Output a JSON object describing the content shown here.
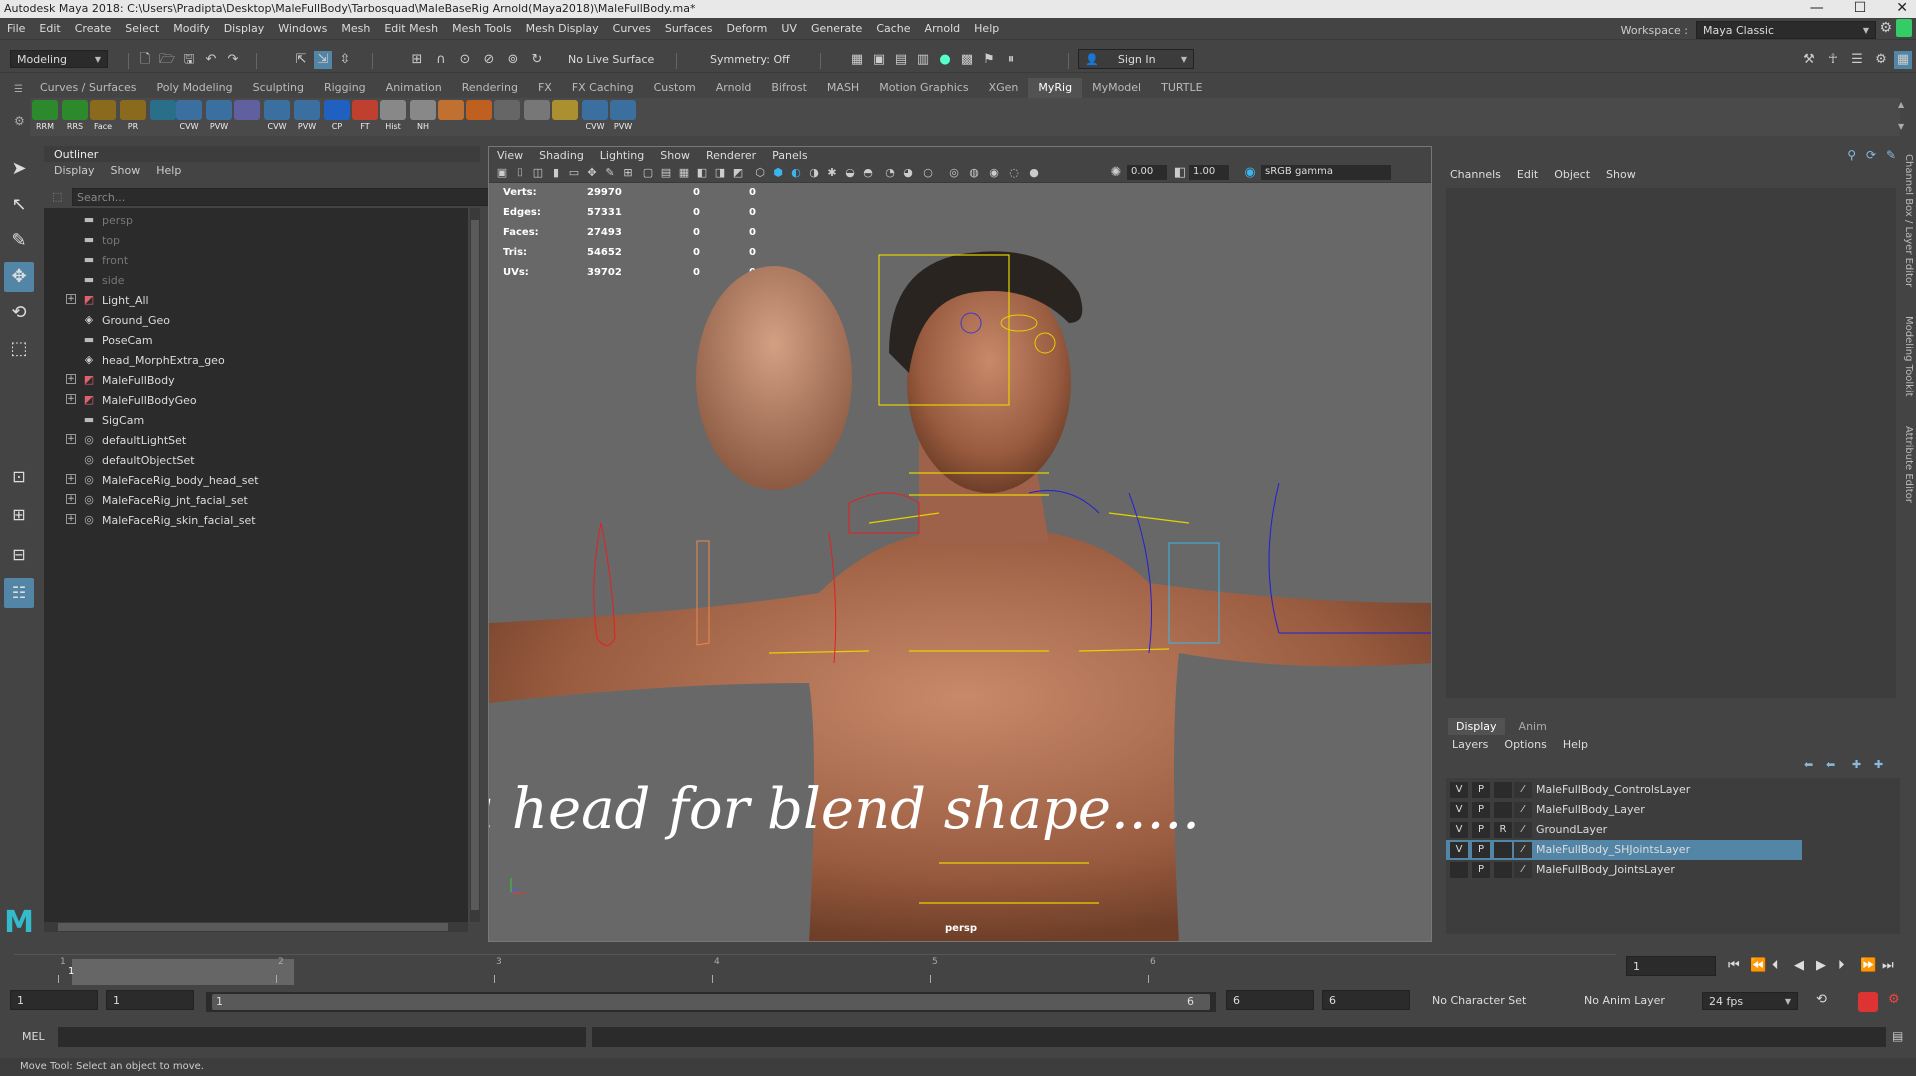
{
  "window": {
    "title": "Autodesk Maya 2018: C:\\Users\\Pradipta\\Desktop\\MaleFullBody\\Tarbosquad\\MaleBaseRig Arnold(Maya2018)\\MaleFullBody.ma*",
    "minimize": "—",
    "maximize": "☐",
    "close": "✕"
  },
  "menubar": {
    "items": [
      "File",
      "Edit",
      "Create",
      "Select",
      "Modify",
      "Display",
      "Windows",
      "Mesh",
      "Edit Mesh",
      "Mesh Tools",
      "Mesh Display",
      "Curves",
      "Surfaces",
      "Deform",
      "UV",
      "Generate",
      "Cache",
      "Arnold",
      "Help"
    ],
    "workspace_label": "Workspace :",
    "workspace_value": "Maya Classic"
  },
  "statusline": {
    "mode": "Modeling",
    "live_surface": "No Live Surface",
    "symmetry": "Symmetry: Off",
    "sign_in": "Sign In"
  },
  "shelf": {
    "tabs": [
      "Curves / Surfaces",
      "Poly Modeling",
      "Sculpting",
      "Rigging",
      "Animation",
      "Rendering",
      "FX",
      "FX Caching",
      "Custom",
      "Arnold",
      "Bifrost",
      "MASH",
      "Motion Graphics",
      "XGen",
      "MyRig",
      "MyModel",
      "TURTLE"
    ],
    "active_tab": "MyRig",
    "buttons": [
      "RRM",
      "RRS",
      "Face",
      "PR",
      "",
      "CVW",
      "PVW",
      "",
      "CVW",
      "PVW",
      "CP",
      "FT",
      "Hist",
      "NH",
      "",
      "",
      "",
      "",
      "",
      "CVW",
      "PVW"
    ]
  },
  "outliner": {
    "title": "Outliner",
    "menu": [
      "Display",
      "Show",
      "Help"
    ],
    "search_placeholder": "Search...",
    "items": [
      {
        "name": "persp",
        "icon": "camera-icon",
        "expand": false,
        "dim": true
      },
      {
        "name": "top",
        "icon": "camera-icon",
        "expand": false,
        "dim": true
      },
      {
        "name": "front",
        "icon": "camera-icon",
        "expand": false,
        "dim": true
      },
      {
        "name": "side",
        "icon": "camera-icon",
        "expand": false,
        "dim": true
      },
      {
        "name": "Light_All",
        "icon": "group-icon",
        "expand": true,
        "dim": false
      },
      {
        "name": "Ground_Geo",
        "icon": "mesh-icon",
        "expand": false,
        "dim": false
      },
      {
        "name": "PoseCam",
        "icon": "camera-icon",
        "expand": false,
        "dim": false
      },
      {
        "name": "head_MorphExtra_geo",
        "icon": "mesh-icon",
        "expand": false,
        "dim": false
      },
      {
        "name": "MaleFullBody",
        "icon": "group-icon",
        "expand": true,
        "dim": false
      },
      {
        "name": "MaleFullBodyGeo",
        "icon": "group-icon",
        "expand": true,
        "dim": false
      },
      {
        "name": "SigCam",
        "icon": "camera-icon",
        "expand": false,
        "dim": false
      },
      {
        "name": "defaultLightSet",
        "icon": "set-icon",
        "expand": true,
        "dim": false
      },
      {
        "name": "defaultObjectSet",
        "icon": "set-icon",
        "expand": false,
        "dim": false
      },
      {
        "name": "MaleFaceRig_body_head_set",
        "icon": "set-icon",
        "expand": true,
        "dim": false
      },
      {
        "name": "MaleFaceRig_jnt_facial_set",
        "icon": "set-icon",
        "expand": true,
        "dim": false
      },
      {
        "name": "MaleFaceRig_skin_facial_set",
        "icon": "set-icon",
        "expand": true,
        "dim": false
      }
    ]
  },
  "viewport": {
    "menu": [
      "View",
      "Shading",
      "Lighting",
      "Show",
      "Renderer",
      "Panels"
    ],
    "exposure": "0.00",
    "gamma": "1.00",
    "color_space": "sRGB gamma",
    "camera_label": "persp",
    "overlay_text": "Extra head for blend shape.....",
    "hud": [
      {
        "label": "Verts:",
        "v1": "29970",
        "v2": "0",
        "v3": "0"
      },
      {
        "label": "Edges:",
        "v1": "57331",
        "v2": "0",
        "v3": "0"
      },
      {
        "label": "Faces:",
        "v1": "27493",
        "v2": "0",
        "v3": "0"
      },
      {
        "label": "Tris:",
        "v1": "54652",
        "v2": "0",
        "v3": "0"
      },
      {
        "label": "UVs:",
        "v1": "39702",
        "v2": "0",
        "v3": "0"
      }
    ]
  },
  "channelbox": {
    "menu": [
      "Channels",
      "Edit",
      "Object",
      "Show"
    ]
  },
  "layer_editor": {
    "tabs": [
      "Display",
      "Anim"
    ],
    "active_tab": "Display",
    "menu": [
      "Layers",
      "Options",
      "Help"
    ],
    "layers": [
      {
        "v": "V",
        "p": "P",
        "r": "",
        "name": "MaleFullBody_ControlsLayer",
        "selected": false
      },
      {
        "v": "V",
        "p": "P",
        "r": "",
        "name": "MaleFullBody_Layer",
        "selected": false
      },
      {
        "v": "V",
        "p": "P",
        "r": "R",
        "name": "GroundLayer",
        "selected": false
      },
      {
        "v": "V",
        "p": "P",
        "r": "",
        "name": "MaleFullBody_SHJointsLayer",
        "selected": true
      },
      {
        "v": "",
        "p": "P",
        "r": "",
        "name": "MaleFullBody_JointsLayer",
        "selected": false
      }
    ]
  },
  "side_tabs": [
    "Channel Box / Layer Editor",
    "Modeling Toolkit",
    "Attribute Editor"
  ],
  "timeline": {
    "ticks": [
      "1",
      "2",
      "3",
      "4",
      "5",
      "6"
    ],
    "current_frame_label": "1",
    "current_frame_field": "1"
  },
  "range": {
    "start": "1",
    "playback_start": "1",
    "slider_start": "1",
    "slider_end": "6",
    "playback_end": "6",
    "end": "6",
    "character_set": "No Character Set",
    "anim_layer": "No Anim Layer",
    "fps": "24 fps"
  },
  "cmdline": {
    "label": "MEL"
  },
  "helpline": {
    "text": "Move Tool: Select an object to move."
  }
}
